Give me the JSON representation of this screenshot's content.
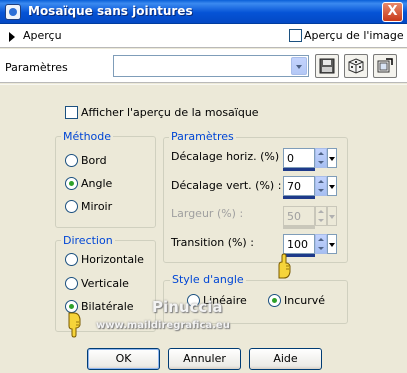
{
  "window": {
    "title": "Mosaïque sans jointures",
    "close_glyph": "X"
  },
  "preview_row": {
    "apercu_label": "Aperçu",
    "apercu_image_label": "Aperçu de l'image",
    "apercu_image_checked": false
  },
  "presets_row": {
    "label": "Paramètres",
    "selected_value": ""
  },
  "options": {
    "afficher_label": "Afficher l'aperçu de la mosaïque",
    "afficher_checked": false
  },
  "methode": {
    "legend": "Méthode",
    "options": [
      "Bord",
      "Angle",
      "Miroir"
    ],
    "selected": "Angle"
  },
  "direction": {
    "legend": "Direction",
    "options": [
      "Horizontale",
      "Verticale",
      "Bilatérale"
    ],
    "selected": "Bilatérale"
  },
  "parametres": {
    "legend": "Paramètres",
    "fields": [
      {
        "label": "Décalage horiz. (%) :",
        "value": "0",
        "enabled": true
      },
      {
        "label": "Décalage vert. (%) :",
        "value": "70",
        "enabled": true
      },
      {
        "label": "Largeur (%) :",
        "value": "50",
        "enabled": false
      },
      {
        "label": "Transition (%) :",
        "value": "100",
        "enabled": true
      }
    ]
  },
  "style_angle": {
    "legend": "Style d'angle",
    "options": [
      "Linéaire",
      "Incurvé"
    ],
    "selected": "Incurvé"
  },
  "buttons": {
    "ok": "OK",
    "annuler": "Annuler",
    "aide": "Aide"
  },
  "watermark": {
    "name": "Pinuccia",
    "url": "www.maildiregrafica.eu"
  },
  "icons": [
    "app-icon",
    "save-preset-icon",
    "random-dice-icon",
    "reset-icon",
    "pointing-hand-icon"
  ]
}
